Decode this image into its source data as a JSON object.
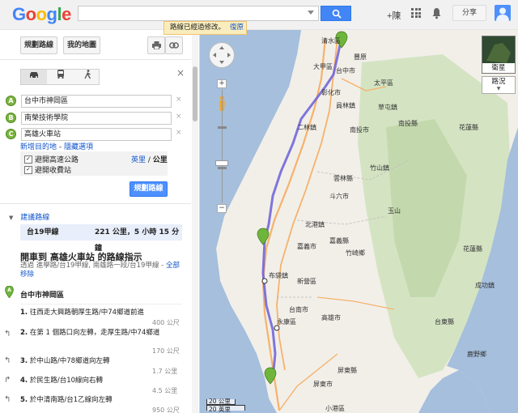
{
  "top": {
    "logo": "Google",
    "search_value": "",
    "plus_me": "+陳",
    "share": "分享"
  },
  "panel": {
    "tab_directions": "規劃路線",
    "tab_my_maps": "我的地圖",
    "waypoints": [
      {
        "marker": "A",
        "value": "台中市神岡區"
      },
      {
        "marker": "B",
        "value": "南榮技術學院"
      },
      {
        "marker": "C",
        "value": "高雄火車站"
      }
    ],
    "add_destination": "新增目的地",
    "hide_options": "隱藏選項",
    "avoid_highways": "避開高速公路",
    "avoid_tolls": "避開收費站",
    "unit_miles": "英里",
    "unit_km": "公里",
    "plan_button": "規劃路線",
    "suggested_routes": "建議路線",
    "route_name": "台19甲線",
    "route_summary": "221 公里，5 小時 15 分鐘",
    "directions_title": "開車到 高雄火車站 的路線指示",
    "via_text": "透過 進學路/台19甲線, 南雄路一段/台19甲線 -",
    "show_all": "全部移除",
    "start": "台中市神岡區",
    "steps": [
      {
        "n": "1.",
        "text": "往西走大興路朝厚生路/中74鄉道前進",
        "dist": "400 公尺"
      },
      {
        "n": "2.",
        "text": "在第 1 個路口向左轉，走厚生路/中74鄉道",
        "dist": "170 公尺"
      },
      {
        "n": "3.",
        "text": "於中山路/中78鄉道向左轉",
        "dist": "1.7 公里"
      },
      {
        "n": "4.",
        "text": "於民生路/台10線向右轉",
        "dist": "4.5 公里"
      },
      {
        "n": "5.",
        "text": "於中清南路/台1乙線向左轉",
        "dist": "950 公尺"
      }
    ]
  },
  "map": {
    "toast_text": "路線已經過修改。",
    "toast_undo": "復原",
    "satellite": "衛星",
    "traffic": "路況",
    "scale_km": "20 公里",
    "scale_mi": "20 英里",
    "labels": [
      {
        "t": "清水區",
        "k": "c"
      },
      {
        "t": "台中市",
        "k": "c"
      },
      {
        "t": "豐原",
        "k": "c"
      },
      {
        "t": "大甲區",
        "k": "c"
      },
      {
        "t": "太平區",
        "k": "c"
      },
      {
        "t": "彰化市",
        "k": "c"
      },
      {
        "t": "草屯鎮",
        "k": "c"
      },
      {
        "t": "員林鎮",
        "k": "c"
      },
      {
        "t": "南投縣",
        "k": "c"
      },
      {
        "t": "南投市",
        "k": "c"
      },
      {
        "t": "二林鎮",
        "k": "c"
      },
      {
        "t": "竹山鎮",
        "k": "c"
      },
      {
        "t": "斗六市",
        "k": "c"
      },
      {
        "t": "雲林縣",
        "k": "c"
      },
      {
        "t": "北港鎮",
        "k": "c"
      },
      {
        "t": "嘉義縣",
        "k": "c"
      },
      {
        "t": "嘉義市",
        "k": "c"
      },
      {
        "t": "竹崎鄉",
        "k": "c"
      },
      {
        "t": "玉山",
        "k": "c"
      },
      {
        "t": "布袋鎮",
        "k": "c"
      },
      {
        "t": "台南市",
        "k": "c"
      },
      {
        "t": "新營區",
        "k": "c"
      },
      {
        "t": "永康區",
        "k": "c"
      },
      {
        "t": "高雄市",
        "k": "c"
      },
      {
        "t": "屏東縣",
        "k": "c"
      },
      {
        "t": "屏東市",
        "k": "c"
      },
      {
        "t": "花蓮縣",
        "k": "c"
      },
      {
        "t": "花蓮縣",
        "k": "c"
      },
      {
        "t": "台東縣",
        "k": "c"
      },
      {
        "t": "小港區",
        "k": "c"
      },
      {
        "t": "鹿野鄉",
        "k": "c"
      },
      {
        "t": "成功鎮",
        "k": "c"
      }
    ]
  }
}
